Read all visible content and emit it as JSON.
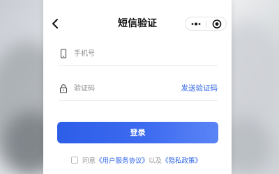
{
  "header": {
    "title": "短信验证"
  },
  "form": {
    "phone_placeholder": "手机号",
    "code_placeholder": "验证码",
    "send_code_label": "发送验证码"
  },
  "login_button": {
    "label": "登录"
  },
  "agreement": {
    "prefix": "同意",
    "user_agreement": "《用户服务协议》",
    "conjunction": "以及",
    "privacy_policy": "《隐私政策》"
  },
  "colors": {
    "accent": "#2d63e6"
  },
  "icons": {
    "back": "chevron-left-icon",
    "menu": "more-dots-icon",
    "close": "target-circle-icon",
    "phone": "mobile-phone-icon",
    "lock": "lock-icon"
  }
}
